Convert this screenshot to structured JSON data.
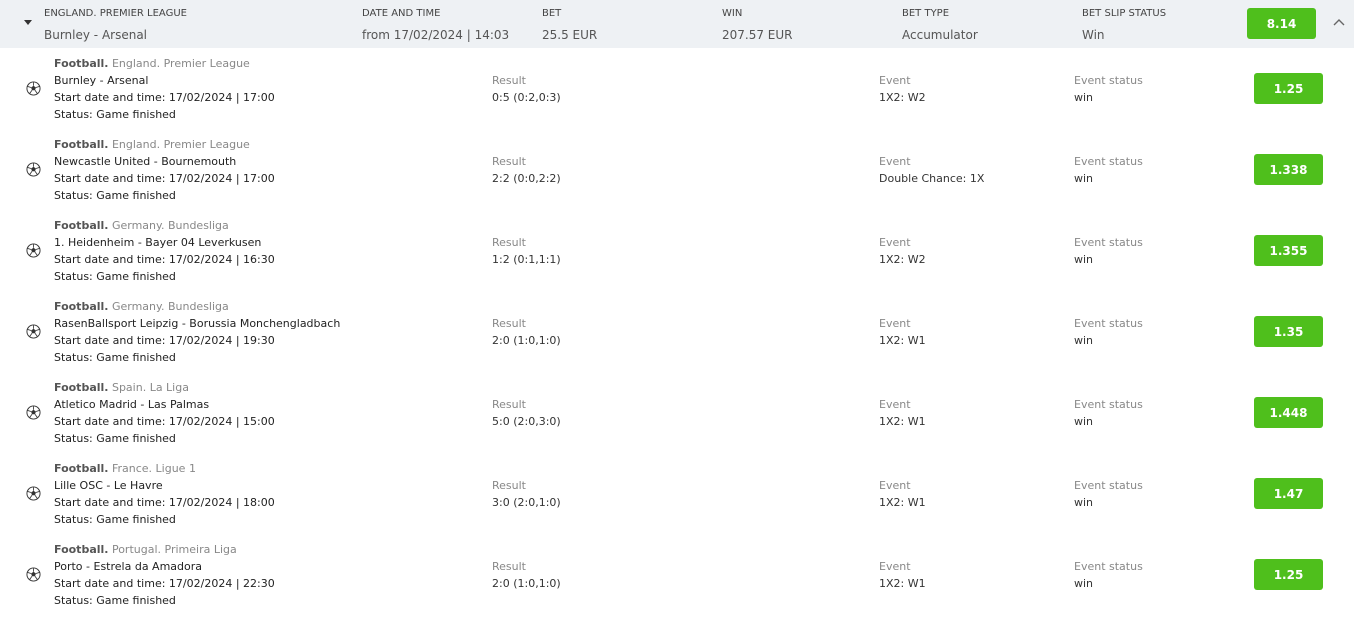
{
  "header": {
    "league": "ENGLAND. PREMIER LEAGUE",
    "match": "Burnley - Arsenal",
    "date_label": "DATE AND TIME",
    "date_value": "from 17/02/2024 | 14:03",
    "bet_label": "BET",
    "bet_value": "25.5 EUR",
    "win_label": "WIN",
    "win_value": "207.57 EUR",
    "type_label": "BET TYPE",
    "type_value": "Accumulator",
    "status_label": "BET SLIP STATUS",
    "status_value": "Win",
    "total_odds": "8.14",
    "colors": {
      "accent": "#4fbf1c",
      "header_bg": "#eef1f4"
    },
    "icons": {
      "expand": "caret-down-icon",
      "collapse": "chevron-up-icon"
    }
  },
  "labels": {
    "result": "Result",
    "event": "Event",
    "event_status": "Event status",
    "start_prefix": "Start date and time: ",
    "status_prefix": "Status: "
  },
  "events": [
    {
      "sport": "Football.",
      "league": " England. Premier League",
      "match": "Burnley - Arsenal",
      "start": "17/02/2024 | 17:00",
      "status": "Game finished",
      "result": "0:5 (0:2,0:3)",
      "event": "1X2: W2",
      "event_status": "win",
      "odds": "1.25"
    },
    {
      "sport": "Football.",
      "league": " England. Premier League",
      "match": "Newcastle United - Bournemouth",
      "start": "17/02/2024 | 17:00",
      "status": "Game finished",
      "result": "2:2 (0:0,2:2)",
      "event": "Double Chance: 1X",
      "event_status": "win",
      "odds": "1.338"
    },
    {
      "sport": "Football.",
      "league": " Germany. Bundesliga",
      "match": "1. Heidenheim - Bayer 04 Leverkusen",
      "start": "17/02/2024 | 16:30",
      "status": "Game finished",
      "result": "1:2 (0:1,1:1)",
      "event": "1X2: W2",
      "event_status": "win",
      "odds": "1.355"
    },
    {
      "sport": "Football.",
      "league": " Germany. Bundesliga",
      "match": "RasenBallsport Leipzig - Borussia Monchengladbach",
      "start": "17/02/2024 | 19:30",
      "status": "Game finished",
      "result": "2:0 (1:0,1:0)",
      "event": "1X2: W1",
      "event_status": "win",
      "odds": "1.35"
    },
    {
      "sport": "Football.",
      "league": " Spain. La Liga",
      "match": "Atletico Madrid - Las Palmas",
      "start": "17/02/2024 | 15:00",
      "status": "Game finished",
      "result": "5:0 (2:0,3:0)",
      "event": "1X2: W1",
      "event_status": "win",
      "odds": "1.448"
    },
    {
      "sport": "Football.",
      "league": " France. Ligue 1",
      "match": "Lille OSC - Le Havre",
      "start": "17/02/2024 | 18:00",
      "status": "Game finished",
      "result": "3:0 (2:0,1:0)",
      "event": "1X2: W1",
      "event_status": "win",
      "odds": "1.47"
    },
    {
      "sport": "Football.",
      "league": " Portugal. Primeira Liga",
      "match": "Porto - Estrela da Amadora",
      "start": "17/02/2024 | 22:30",
      "status": "Game finished",
      "result": "2:0 (1:0,1:0)",
      "event": "1X2: W1",
      "event_status": "win",
      "odds": "1.25"
    }
  ]
}
